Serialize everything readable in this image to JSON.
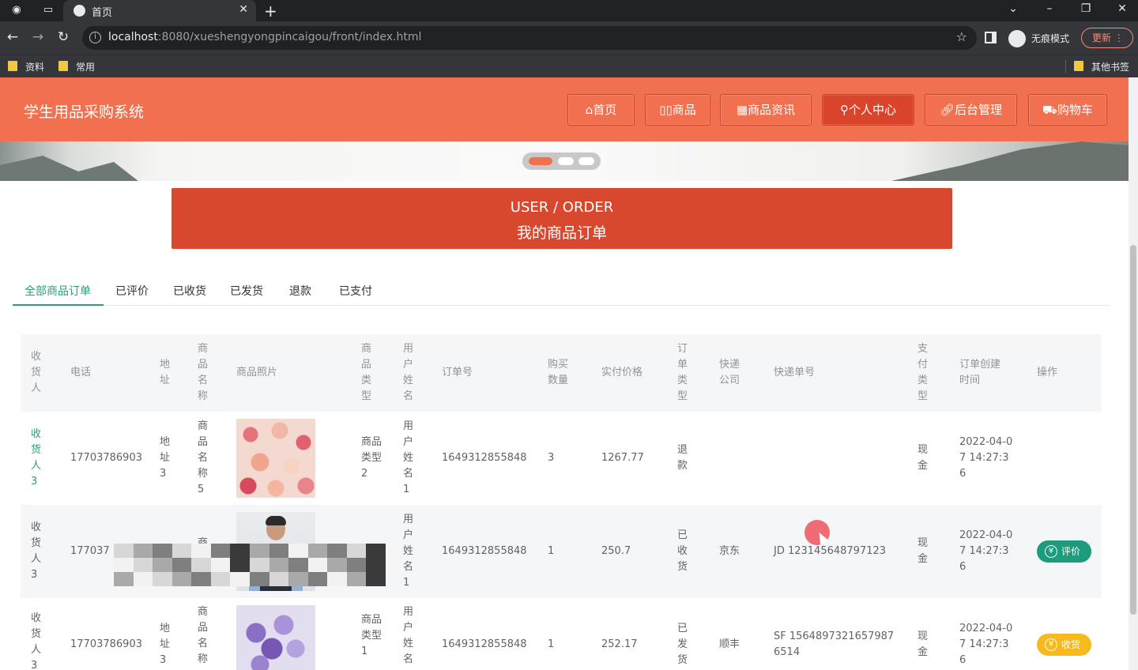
{
  "browser": {
    "tab_title": "首页",
    "url_host": "localhost",
    "url_rest": ":8080/xueshengyongpincaigou/front/index.html",
    "incognito_label": "无痕模式",
    "update_label": "更新",
    "bookmarks": [
      "资料",
      "常用",
      "其他书签"
    ]
  },
  "site": {
    "title": "学生用品采购系统",
    "nav": [
      {
        "label": "首页",
        "icon": "home-icon"
      },
      {
        "label": "商品",
        "icon": "goods-icon"
      },
      {
        "label": "商品资讯",
        "icon": "news-icon"
      },
      {
        "label": "个人中心",
        "icon": "user-icon",
        "active": true
      },
      {
        "label": "后台管理",
        "icon": "link-icon"
      },
      {
        "label": "购物车",
        "icon": "cart-icon"
      }
    ]
  },
  "order_title": {
    "en": "USER / ORDER",
    "cn": "我的商品订单"
  },
  "tabs": [
    "全部商品订单",
    "已评价",
    "已收货",
    "已发货",
    "退款",
    "已支付"
  ],
  "active_tab": 0,
  "table": {
    "headers": {
      "consignee": "收货人",
      "phone": "电话",
      "address": "地址",
      "product_name": "商品名称",
      "photo": "商品照片",
      "product_type": "商品类型",
      "user_name": "用户姓名",
      "order_no": "订单号",
      "qty": "购买数量",
      "price": "实付价格",
      "order_type": "订单类型",
      "express": "快递公司",
      "express_no": "快递单号",
      "pay_type": "支付类型",
      "created": "订单创建时间",
      "op": "操作"
    },
    "rows": [
      {
        "consignee": "收货人3",
        "phone": "17703786903",
        "address": "地址3",
        "product_name": "商品名称5",
        "photo": "roses-photo",
        "product_type": "商品类型2",
        "user_name": "用户姓名1",
        "order_no": "1649312855848",
        "qty": "3",
        "price": "1267.77",
        "order_type": "退款",
        "express": "",
        "express_no": "",
        "pay_type": "现金",
        "created": "2022-04-07 14:27:36",
        "op": ""
      },
      {
        "consignee": "收货人3",
        "phone": "177037",
        "address": "地",
        "product_name": "商品",
        "photo": "person-photo",
        "product_type": "商品",
        "user_name": "用户姓名1",
        "order_no": "1649312855848",
        "qty": "1",
        "price": "250.7",
        "order_type": "已收货",
        "express": "京东",
        "express_no": "JD 123145648797123",
        "pay_type": "现金",
        "created": "2022-04-07 14:27:36",
        "op": "评价"
      },
      {
        "consignee": "收货人3",
        "phone": "17703786903",
        "address": "地址3",
        "product_name": "商品名称",
        "photo": "lilac-photo",
        "product_type": "商品类型1",
        "user_name": "用户姓名",
        "order_no": "1649312855848",
        "qty": "1",
        "price": "252.17",
        "order_type": "已发货",
        "express": "顺丰",
        "express_no": "SF 15648973216579876514",
        "pay_type": "现金",
        "created": "2022-04-07 14:27:36",
        "op": "收货"
      }
    ]
  },
  "colors": {
    "header_bg": "#f07050",
    "title_bg": "#d8482f",
    "active_tab": "#26a17a",
    "review_button": "#1c9c7b",
    "receive_button": "#f7ba1e"
  }
}
